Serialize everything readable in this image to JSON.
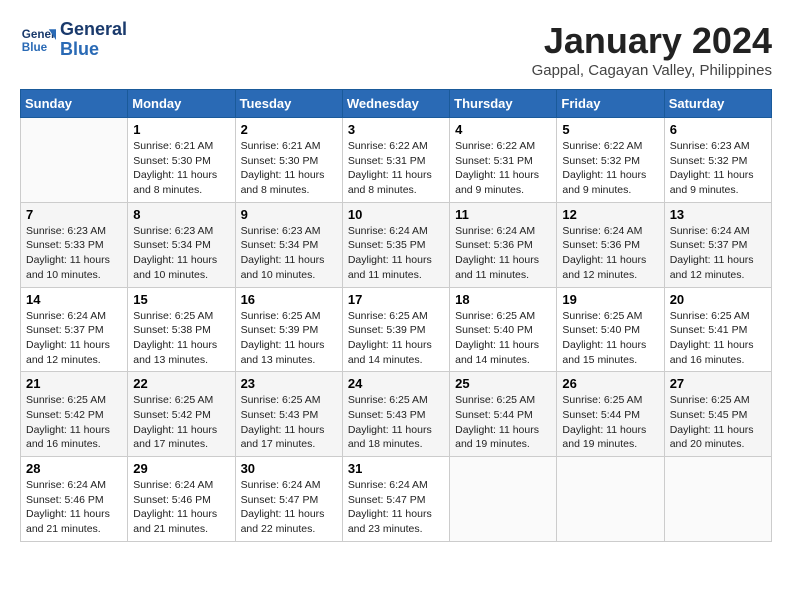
{
  "logo": {
    "line1": "General",
    "line2": "Blue"
  },
  "title": "January 2024",
  "subtitle": "Gappal, Cagayan Valley, Philippines",
  "headers": [
    "Sunday",
    "Monday",
    "Tuesday",
    "Wednesday",
    "Thursday",
    "Friday",
    "Saturday"
  ],
  "weeks": [
    [
      {
        "day": "",
        "content": ""
      },
      {
        "day": "1",
        "content": "Sunrise: 6:21 AM\nSunset: 5:30 PM\nDaylight: 11 hours\nand 8 minutes."
      },
      {
        "day": "2",
        "content": "Sunrise: 6:21 AM\nSunset: 5:30 PM\nDaylight: 11 hours\nand 8 minutes."
      },
      {
        "day": "3",
        "content": "Sunrise: 6:22 AM\nSunset: 5:31 PM\nDaylight: 11 hours\nand 8 minutes."
      },
      {
        "day": "4",
        "content": "Sunrise: 6:22 AM\nSunset: 5:31 PM\nDaylight: 11 hours\nand 9 minutes."
      },
      {
        "day": "5",
        "content": "Sunrise: 6:22 AM\nSunset: 5:32 PM\nDaylight: 11 hours\nand 9 minutes."
      },
      {
        "day": "6",
        "content": "Sunrise: 6:23 AM\nSunset: 5:32 PM\nDaylight: 11 hours\nand 9 minutes."
      }
    ],
    [
      {
        "day": "7",
        "content": "Sunrise: 6:23 AM\nSunset: 5:33 PM\nDaylight: 11 hours\nand 10 minutes."
      },
      {
        "day": "8",
        "content": "Sunrise: 6:23 AM\nSunset: 5:34 PM\nDaylight: 11 hours\nand 10 minutes."
      },
      {
        "day": "9",
        "content": "Sunrise: 6:23 AM\nSunset: 5:34 PM\nDaylight: 11 hours\nand 10 minutes."
      },
      {
        "day": "10",
        "content": "Sunrise: 6:24 AM\nSunset: 5:35 PM\nDaylight: 11 hours\nand 11 minutes."
      },
      {
        "day": "11",
        "content": "Sunrise: 6:24 AM\nSunset: 5:36 PM\nDaylight: 11 hours\nand 11 minutes."
      },
      {
        "day": "12",
        "content": "Sunrise: 6:24 AM\nSunset: 5:36 PM\nDaylight: 11 hours\nand 12 minutes."
      },
      {
        "day": "13",
        "content": "Sunrise: 6:24 AM\nSunset: 5:37 PM\nDaylight: 11 hours\nand 12 minutes."
      }
    ],
    [
      {
        "day": "14",
        "content": "Sunrise: 6:24 AM\nSunset: 5:37 PM\nDaylight: 11 hours\nand 12 minutes."
      },
      {
        "day": "15",
        "content": "Sunrise: 6:25 AM\nSunset: 5:38 PM\nDaylight: 11 hours\nand 13 minutes."
      },
      {
        "day": "16",
        "content": "Sunrise: 6:25 AM\nSunset: 5:39 PM\nDaylight: 11 hours\nand 13 minutes."
      },
      {
        "day": "17",
        "content": "Sunrise: 6:25 AM\nSunset: 5:39 PM\nDaylight: 11 hours\nand 14 minutes."
      },
      {
        "day": "18",
        "content": "Sunrise: 6:25 AM\nSunset: 5:40 PM\nDaylight: 11 hours\nand 14 minutes."
      },
      {
        "day": "19",
        "content": "Sunrise: 6:25 AM\nSunset: 5:40 PM\nDaylight: 11 hours\nand 15 minutes."
      },
      {
        "day": "20",
        "content": "Sunrise: 6:25 AM\nSunset: 5:41 PM\nDaylight: 11 hours\nand 16 minutes."
      }
    ],
    [
      {
        "day": "21",
        "content": "Sunrise: 6:25 AM\nSunset: 5:42 PM\nDaylight: 11 hours\nand 16 minutes."
      },
      {
        "day": "22",
        "content": "Sunrise: 6:25 AM\nSunset: 5:42 PM\nDaylight: 11 hours\nand 17 minutes."
      },
      {
        "day": "23",
        "content": "Sunrise: 6:25 AM\nSunset: 5:43 PM\nDaylight: 11 hours\nand 17 minutes."
      },
      {
        "day": "24",
        "content": "Sunrise: 6:25 AM\nSunset: 5:43 PM\nDaylight: 11 hours\nand 18 minutes."
      },
      {
        "day": "25",
        "content": "Sunrise: 6:25 AM\nSunset: 5:44 PM\nDaylight: 11 hours\nand 19 minutes."
      },
      {
        "day": "26",
        "content": "Sunrise: 6:25 AM\nSunset: 5:44 PM\nDaylight: 11 hours\nand 19 minutes."
      },
      {
        "day": "27",
        "content": "Sunrise: 6:25 AM\nSunset: 5:45 PM\nDaylight: 11 hours\nand 20 minutes."
      }
    ],
    [
      {
        "day": "28",
        "content": "Sunrise: 6:24 AM\nSunset: 5:46 PM\nDaylight: 11 hours\nand 21 minutes."
      },
      {
        "day": "29",
        "content": "Sunrise: 6:24 AM\nSunset: 5:46 PM\nDaylight: 11 hours\nand 21 minutes."
      },
      {
        "day": "30",
        "content": "Sunrise: 6:24 AM\nSunset: 5:47 PM\nDaylight: 11 hours\nand 22 minutes."
      },
      {
        "day": "31",
        "content": "Sunrise: 6:24 AM\nSunset: 5:47 PM\nDaylight: 11 hours\nand 23 minutes."
      },
      {
        "day": "",
        "content": ""
      },
      {
        "day": "",
        "content": ""
      },
      {
        "day": "",
        "content": ""
      }
    ]
  ]
}
